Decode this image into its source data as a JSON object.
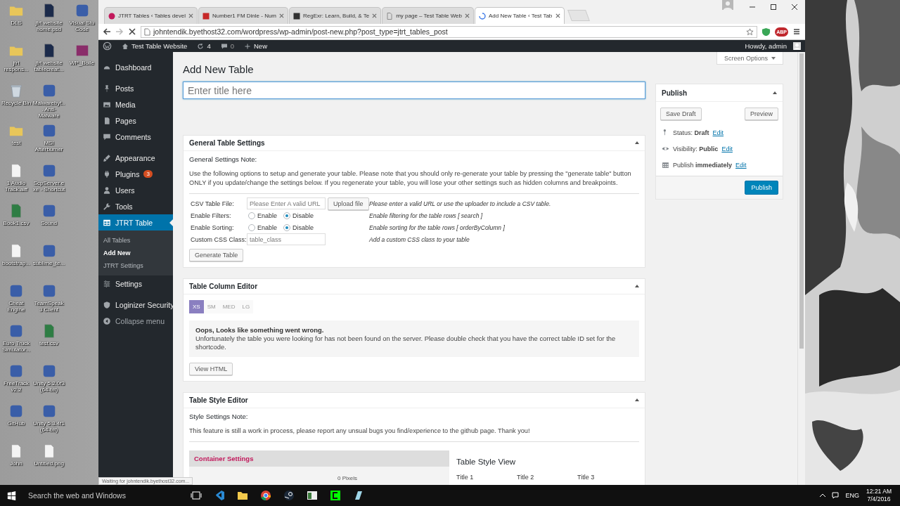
{
  "desktop_icons": [
    {
      "label": "DLS",
      "kind": "folder"
    },
    {
      "label": "jtrt respons...",
      "kind": "folder"
    },
    {
      "label": "Recycle Bin",
      "kind": "bin"
    },
    {
      "label": "test",
      "kind": "folder"
    },
    {
      "label": "1 Audio Track.aiff",
      "kind": "document"
    },
    {
      "label": "Book1.csv",
      "kind": "sheet"
    },
    {
      "label": "bootstrap...",
      "kind": "document"
    },
    {
      "label": "Cheat Engine",
      "kind": "app"
    },
    {
      "label": "Euro Truck Simulator...",
      "kind": "app"
    },
    {
      "label": "FreeTrack v2.2",
      "kind": "app"
    },
    {
      "label": "GitHub",
      "kind": "app"
    },
    {
      "label": "John",
      "kind": "document"
    },
    {
      "label": "jtrt website home.psd",
      "kind": "psd"
    },
    {
      "label": "jtrt website tablecreat...",
      "kind": "psd"
    },
    {
      "label": "Malwarebyt... Anti-Malware",
      "kind": "app"
    },
    {
      "label": "MSI Afterburner",
      "kind": "app"
    },
    {
      "label": "ScpServer.exe - Shortcut",
      "kind": "app"
    },
    {
      "label": "Sound",
      "kind": "app"
    },
    {
      "label": "sublime_te...",
      "kind": "app"
    },
    {
      "label": "TeamSpeak 3 Client",
      "kind": "app"
    },
    {
      "label": "test.csv",
      "kind": "sheet"
    },
    {
      "label": "Unity 5.2.0f3 (64-bit)",
      "kind": "app"
    },
    {
      "label": "Unity 5.3.4f1 (64-bit)",
      "kind": "app"
    },
    {
      "label": "Untitled.png",
      "kind": "document"
    },
    {
      "label": "Visual Stu Code",
      "kind": "app"
    },
    {
      "label": "WP_Boile",
      "kind": "archive"
    }
  ],
  "browser": {
    "tabs": [
      {
        "label": "JTRT Tables ‹ Tables devel",
        "selected": false
      },
      {
        "label": "Number1 FM Dinle - Num",
        "selected": false
      },
      {
        "label": "RegExr: Learn, Build, & Te",
        "selected": false
      },
      {
        "label": "my page – Test Table Web",
        "selected": false
      },
      {
        "label": "Add New Table ‹ Test Tab",
        "selected": true
      }
    ],
    "address": "johntendik.byethost32.com/wordpress/wp-admin/post-new.php?post_type=jtrt_tables_post",
    "adblock_label": "ABP",
    "status": "Waiting for johntendik.byethost32.com..."
  },
  "admin_bar": {
    "site": "Test Table Website",
    "updates": "4",
    "comments": "0",
    "new": "New",
    "greeting": "Howdy, admin"
  },
  "sidebar": {
    "items": [
      {
        "label": "Dashboard",
        "selected": false
      },
      {
        "label": "Posts",
        "selected": false
      },
      {
        "label": "Media",
        "selected": false
      },
      {
        "label": "Pages",
        "selected": false
      },
      {
        "label": "Comments",
        "selected": false
      },
      {
        "label": "Appearance",
        "selected": false
      },
      {
        "label": "Plugins",
        "selected": false,
        "badge": "3"
      },
      {
        "label": "Users",
        "selected": false
      },
      {
        "label": "Tools",
        "selected": false
      },
      {
        "label": "JTRT Table",
        "selected": true,
        "children": [
          {
            "label": "All Tables",
            "selected": false
          },
          {
            "label": "Add New",
            "selected": true
          },
          {
            "label": "JTRT Settings",
            "selected": false
          }
        ]
      },
      {
        "label": "Settings",
        "selected": false
      },
      {
        "label": "Loginizer Security",
        "selected": false
      }
    ],
    "collapse": "Collapse menu"
  },
  "page": {
    "title": "Add New Table",
    "screen_options": "Screen Options",
    "title_field": {
      "placeholder": "Enter title here"
    }
  },
  "general_settings": {
    "heading": "General Table Settings",
    "note_title": "General Settings Note:",
    "note": "Use the following options to setup and generate your table. Please note that you should only re-generate your table by pressing the \"generate table\" button ONLY if you update/change the settings below. If you regenerate your table, you will lose your other settings such as hidden columns and breakpoints.",
    "rows": [
      {
        "kind": "file",
        "label": "CSV Table File:",
        "placeholder": "Please Enter A valid URL",
        "button": "Upload file",
        "hint": "Please enter a valid URL or use the uploader to include a CSV table."
      },
      {
        "kind": "radio",
        "label": "Enable Filters:",
        "options": [
          {
            "label": "Enable",
            "selected": false
          },
          {
            "label": "Disable",
            "selected": true
          }
        ],
        "hint": "Enable filtering for the table rows [ search ]"
      },
      {
        "kind": "radio",
        "label": "Enable Sorting:",
        "options": [
          {
            "label": "Enable",
            "selected": false
          },
          {
            "label": "Disable",
            "selected": true
          }
        ],
        "hint": "Enable sorting for the table rows [ orderByColumn ]"
      },
      {
        "kind": "text",
        "label": "Custom CSS Class:",
        "placeholder": "table_class",
        "hint": "Add a custom CSS class to your table"
      }
    ],
    "button": "Generate Table"
  },
  "column_editor": {
    "heading": "Table Column Editor",
    "breakpoints": [
      {
        "label": "XS",
        "selected": true
      },
      {
        "label": "SM",
        "selected": false
      },
      {
        "label": "MED",
        "selected": false
      },
      {
        "label": "LG",
        "selected": false
      }
    ],
    "error_title": "Oops, Looks like something went wrong.",
    "error_text": "Unfortunately the table you were looking for has not been found on the server. Please double check that you have the correct table ID set for the shortcode.",
    "button": "View HTML"
  },
  "style_editor": {
    "heading": "Table Style Editor",
    "note_title": "Style Settings Note:",
    "note": "This feature is still a work in process, please report any unsual bugs you find/experience to the github page. Thank you!",
    "container_heading": "Container Settings",
    "pixels": "0 Pixels",
    "preview_title": "Table Style View",
    "columns": [
      "Title 1",
      "Title 2",
      "Title 3"
    ]
  },
  "publish": {
    "heading": "Publish",
    "save_draft": "Save Draft",
    "preview": "Preview",
    "meta": [
      {
        "label": "Status:",
        "value": "Draft",
        "link": "Edit"
      },
      {
        "label": "Visibility:",
        "value": "Public",
        "link": "Edit"
      },
      {
        "label": "Publish",
        "value": "immediately",
        "link": "Edit"
      }
    ],
    "button": "Publish"
  },
  "taskbar": {
    "search_placeholder": "Search the web and Windows",
    "language": "ENG",
    "time": "12:21 AM",
    "date": "7/4/2016"
  }
}
